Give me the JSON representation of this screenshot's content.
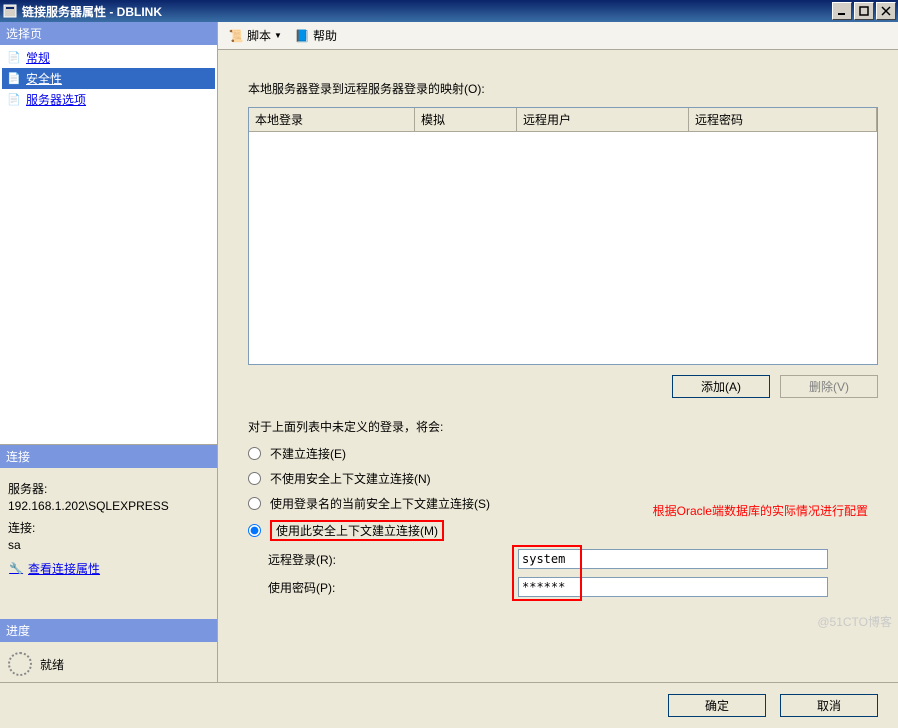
{
  "titlebar": {
    "title": "链接服务器属性 - DBLINK"
  },
  "leftPanel": {
    "selectPageHeader": "选择页",
    "nav": [
      {
        "label": "常规",
        "selected": false
      },
      {
        "label": "安全性",
        "selected": true
      },
      {
        "label": "服务器选项",
        "selected": false
      }
    ],
    "connectionHeader": "连接",
    "serverLabel": "服务器:",
    "serverValue": "192.168.1.202\\SQLEXPRESS",
    "connLabel": "连接:",
    "connValue": "sa",
    "viewConnLink": "查看连接属性",
    "progressHeader": "进度",
    "readyLabel": "就绪"
  },
  "toolbar": {
    "script": "脚本",
    "help": "帮助"
  },
  "main": {
    "mappingLabel": "本地服务器登录到远程服务器登录的映射(O):",
    "columns": {
      "localLogin": "本地登录",
      "impersonate": "模拟",
      "remoteUser": "远程用户",
      "remotePassword": "远程密码"
    },
    "addBtn": "添加(A)",
    "deleteBtn": "删除(V)",
    "undefinedLabel": "对于上面列表中未定义的登录，将会:",
    "radios": {
      "noConnect": "不建立连接(E)",
      "noSecurity": "不使用安全上下文建立连接(N)",
      "currentSecurity": "使用登录名的当前安全上下文建立连接(S)",
      "thisSecurity": "使用此安全上下文建立连接(M)"
    },
    "redNote": "根据Oracle端数据库的实际情况进行配置",
    "remoteLoginLabel": "远程登录(R):",
    "remoteLoginValue": "system",
    "passwordLabel": "使用密码(P):",
    "passwordValue": "******"
  },
  "footer": {
    "ok": "确定",
    "cancel": "取消"
  },
  "watermark": "@51CTO博客"
}
